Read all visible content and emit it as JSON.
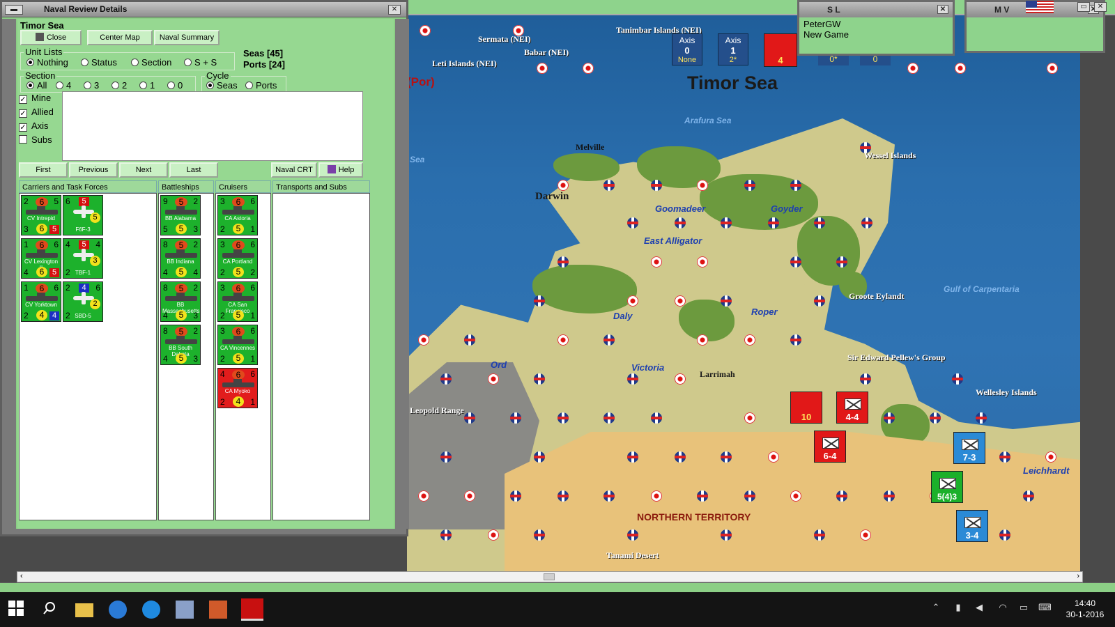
{
  "naval_window": {
    "title": "Naval Review Details",
    "sea_name": "Timor Sea",
    "buttons": {
      "close": "Close",
      "center_map": "Center Map",
      "naval_summary": "Naval Summary",
      "first": "First",
      "previous": "Previous",
      "next": "Next",
      "last": "Last",
      "naval_crt": "Naval CRT",
      "help": "Help"
    },
    "counts": {
      "seas": "Seas [45]",
      "ports": "Ports [24]"
    },
    "unit_lists": {
      "label": "Unit Lists",
      "options": [
        "Nothing",
        "Status",
        "Section",
        "S + S"
      ],
      "selected": "Nothing"
    },
    "section": {
      "label": "Section",
      "options": [
        "All",
        "4",
        "3",
        "2",
        "1",
        "0"
      ],
      "selected": "All"
    },
    "cycle": {
      "label": "Cycle",
      "options": [
        "Seas",
        "Ports"
      ],
      "selected": "Seas"
    },
    "filters": [
      {
        "label": "Mine",
        "checked": true
      },
      {
        "label": "Allied",
        "checked": true
      },
      {
        "label": "Axis",
        "checked": true
      },
      {
        "label": "Subs",
        "checked": false
      }
    ],
    "columns": [
      "Carriers and Task Forces",
      "Battleships",
      "Cruisers",
      "Transports and Subs"
    ],
    "carriers": [
      {
        "tl": "2",
        "top": "6",
        "tr": "5",
        "name": "CV Intrepid",
        "bl": "3",
        "bot": "6",
        "br": "5"
      },
      {
        "tl": "1",
        "top": "6",
        "tr": "6",
        "name": "CV Lexington II",
        "bl": "4",
        "bot": "6",
        "br": "5"
      },
      {
        "tl": "1",
        "top": "6",
        "tr": "6",
        "name": "CV Yorktown",
        "bl": "2",
        "bot": "4",
        "br": "4"
      }
    ],
    "aircraft": [
      {
        "tl": "6",
        "badge": "5",
        "tr": "",
        "ybadge": "5",
        "name": "F6F-3",
        "bl": ""
      },
      {
        "tl": "4",
        "badge": "5",
        "tr": "4",
        "ybadge": "3",
        "name": "TBF-1",
        "bl": "2"
      },
      {
        "tl": "2",
        "badge": "4",
        "tr": "6",
        "ybadge": "2",
        "name": "SBD-5",
        "bl": "2"
      }
    ],
    "battleships": [
      {
        "tl": "9",
        "top": "5",
        "tr": "2",
        "name": "BB Alabama",
        "bl": "5",
        "bot": "5",
        "br": "3"
      },
      {
        "tl": "8",
        "top": "5",
        "tr": "2",
        "name": "BB Indiana",
        "bl": "4",
        "bot": "5",
        "br": "4"
      },
      {
        "tl": "8",
        "top": "5",
        "tr": "2",
        "name": "BB Massachusetts",
        "bl": "4",
        "bot": "5",
        "br": "3"
      },
      {
        "tl": "8",
        "top": "5",
        "tr": "2",
        "name": "BB South Dakota",
        "bl": "4",
        "bot": "5",
        "br": "3"
      }
    ],
    "cruisers": [
      {
        "tl": "3",
        "top": "6",
        "tr": "6",
        "name": "CA Astoria",
        "bl": "2",
        "bot": "5",
        "br": "1",
        "color": "green"
      },
      {
        "tl": "3",
        "top": "6",
        "tr": "6",
        "name": "CA Portland",
        "bl": "2",
        "bot": "5",
        "br": "2",
        "color": "green"
      },
      {
        "tl": "3",
        "top": "6",
        "tr": "6",
        "name": "CA San Francisco",
        "bl": "2",
        "bot": "5",
        "br": "1",
        "color": "green"
      },
      {
        "tl": "3",
        "top": "6",
        "tr": "6",
        "name": "CA Vincennes",
        "bl": "2",
        "bot": "5",
        "br": "1",
        "color": "green"
      },
      {
        "tl": "4",
        "top": "6",
        "tr": "6",
        "name": "CA Myoko",
        "bl": "2",
        "bot": "4",
        "br": "1",
        "color": "red"
      }
    ]
  },
  "mini_windows": {
    "sl": {
      "title": "S L",
      "line1": "PeterGW",
      "line2": "New Game"
    },
    "mv": {
      "title": "M V"
    }
  },
  "map": {
    "axis_boxes": [
      {
        "title": "Axis",
        "num": "0",
        "sub": "None"
      },
      {
        "title": "Axis",
        "num": "1",
        "sub": "2*"
      }
    ],
    "status_values": [
      "0*",
      "0"
    ],
    "labels": {
      "timor_sea": "Timor Sea",
      "arafura_sea": "Arafura Sea",
      "tanimbar": "Tanimbar Islands (NEI)",
      "sermata": "Sermata (NEI)",
      "babar": "Babar (NEI)",
      "leti": "Leti Islands (NEI)",
      "por": "(Por)",
      "sea_left": "Sea",
      "melville": "Melville",
      "darwin": "Darwin",
      "wessel": "Wessel Islands",
      "goomadeer": "Goomadeer",
      "goyder": "Goyder",
      "east_alligator": "East Alligator",
      "daly": "Daly",
      "roper": "Roper",
      "groote": "Groote Eylandt",
      "gulf": "Gulf of Carpentaria",
      "ord": "Ord",
      "victoria": "Victoria",
      "larrimah": "Larrimah",
      "pellew": "Sir Edward Pellew's Group",
      "wellesley": "Wellesley Islands",
      "leopold": "Leopold Range",
      "leichhardt": "Leichhardt",
      "northern_territory": "NORTHERN TERRITORY",
      "tanami": "Tanami Desert"
    },
    "counters": [
      {
        "color": "red",
        "value": "4-4"
      },
      {
        "color": "red",
        "value": "6-4"
      },
      {
        "color": "red",
        "value": "10"
      },
      {
        "color": "blue",
        "value": "7-3"
      },
      {
        "color": "green",
        "value": "5(4)3"
      },
      {
        "color": "blue",
        "value": "3-4"
      }
    ]
  },
  "taskbar": {
    "time": "14:40",
    "date": "30-1-2016"
  },
  "colors": {
    "window_green": "#8ccf86",
    "sea_blue": "#2a6ead",
    "unit_green": "#1db12c",
    "unit_red": "#e21c1c"
  }
}
